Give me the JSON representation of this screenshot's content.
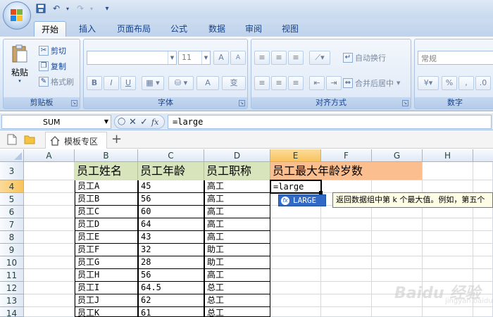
{
  "quick_access": {
    "dropdown_glyph": "▾"
  },
  "tabs": [
    {
      "label": "开始",
      "active": true
    },
    {
      "label": "插入"
    },
    {
      "label": "页面布局"
    },
    {
      "label": "公式"
    },
    {
      "label": "数据"
    },
    {
      "label": "审阅"
    },
    {
      "label": "视图"
    }
  ],
  "ribbon": {
    "clipboard": {
      "label": "剪贴板",
      "paste": "粘贴",
      "cut": "剪切",
      "copy": "复制",
      "format_painter": "格式刷"
    },
    "font": {
      "label": "字体",
      "font_name": "",
      "font_size": "11",
      "bold": "B",
      "italic": "I",
      "underline": "U",
      "grow": "A",
      "shrink": "A",
      "font_color": "A",
      "phonetic": "变"
    },
    "alignment": {
      "label": "对齐方式",
      "wrap_text": "自动换行",
      "merge_center": "合并后居中"
    },
    "number": {
      "label": "数字",
      "format": "常规",
      "percent": "%",
      "comma": ","
    }
  },
  "formula_bar": {
    "name_box": "SUM",
    "cancel": "✕",
    "enter": "✓",
    "fx": "fx",
    "formula": "=large"
  },
  "doc_tabs": {
    "template_tab": "模板专区",
    "add": "+"
  },
  "columns": [
    "A",
    "B",
    "C",
    "D",
    "E",
    "F",
    "G",
    "H"
  ],
  "rows": [
    "3",
    "4",
    "5",
    "6",
    "7",
    "8",
    "9",
    "10",
    "11",
    "12",
    "13",
    "14"
  ],
  "table": {
    "headers": [
      "员工姓名",
      "员工年龄",
      "员工职称"
    ],
    "title_cell": "员工最大年龄岁数",
    "data": [
      [
        "员工A",
        "45",
        "高工"
      ],
      [
        "员工B",
        "56",
        "高工"
      ],
      [
        "员工C",
        "60",
        "高工"
      ],
      [
        "员工D",
        "64",
        "高工"
      ],
      [
        "员工E",
        "43",
        "高工"
      ],
      [
        "员工F",
        "32",
        "助工"
      ],
      [
        "员工G",
        "28",
        "助工"
      ],
      [
        "员工H",
        "56",
        "高工"
      ],
      [
        "员工I",
        "64.5",
        "总工"
      ],
      [
        "员工J",
        "62",
        "总工"
      ],
      [
        "员工K",
        "61",
        "总工"
      ]
    ],
    "active_cell_value": "=large"
  },
  "autocomplete": {
    "item": "LARGE",
    "tooltip": "返回数据组中第 k 个最大值。例如，第五个"
  },
  "watermark": {
    "text": "Baidu 经验",
    "sub": "jingyan.baidu.com"
  }
}
